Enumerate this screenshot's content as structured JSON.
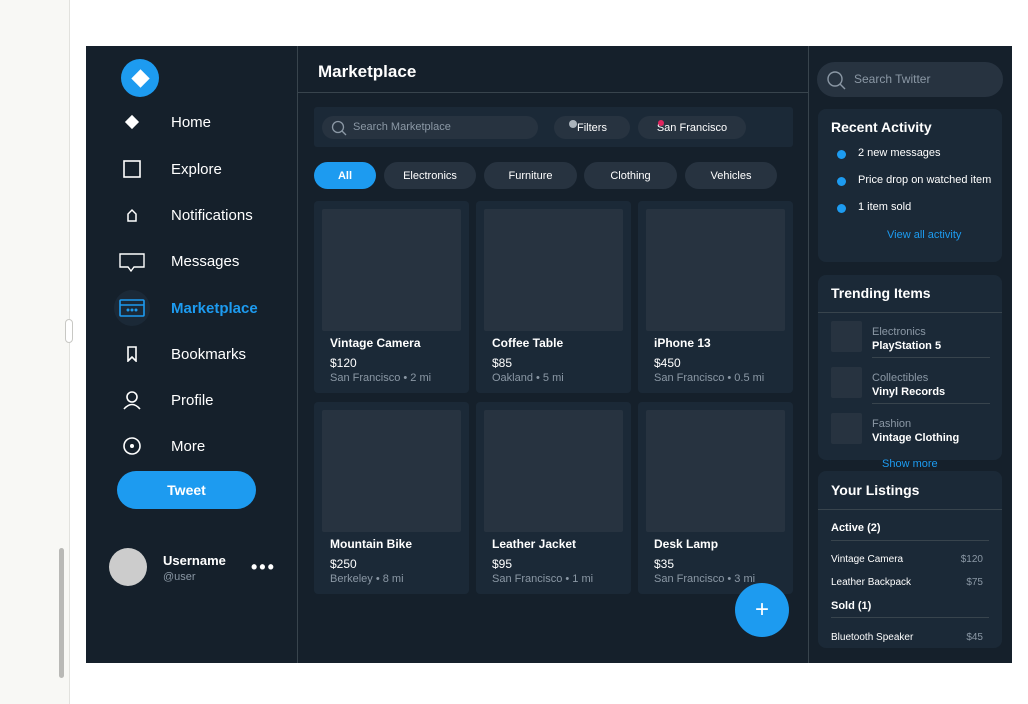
{
  "sidebar": {
    "nav": [
      {
        "label": "Home",
        "icon": "home-diamond-icon"
      },
      {
        "label": "Explore",
        "icon": "explore-square-icon"
      },
      {
        "label": "Notifications",
        "icon": "bell-icon"
      },
      {
        "label": "Messages",
        "icon": "message-bubble-icon"
      },
      {
        "label": "Marketplace",
        "icon": "storefront-icon",
        "active": true
      },
      {
        "label": "Bookmarks",
        "icon": "bookmark-icon"
      },
      {
        "label": "Profile",
        "icon": "user-icon"
      },
      {
        "label": "More",
        "icon": "more-circle-icon"
      }
    ],
    "tweet_label": "Tweet",
    "user": {
      "name": "Username",
      "handle": "@user",
      "more": "•••"
    }
  },
  "main": {
    "title": "Marketplace",
    "search_placeholder": "Search Marketplace",
    "filters_label": "Filters",
    "location_label": "San Francisco",
    "categories": [
      "All",
      "Electronics",
      "Furniture",
      "Clothing",
      "Vehicles"
    ],
    "active_category": "All",
    "listings": [
      {
        "title": "Vintage Camera",
        "price": "$120",
        "location": "San Francisco • 2 mi"
      },
      {
        "title": "Coffee Table",
        "price": "$85",
        "location": "Oakland • 5 mi"
      },
      {
        "title": "iPhone 13",
        "price": "$450",
        "location": "San Francisco • 0.5 mi"
      },
      {
        "title": "Mountain Bike",
        "price": "$250",
        "location": "Berkeley • 8 mi"
      },
      {
        "title": "Leather Jacket",
        "price": "$95",
        "location": "San Francisco • 1 mi"
      },
      {
        "title": "Desk Lamp",
        "price": "$35",
        "location": "San Francisco • 3 mi"
      }
    ],
    "fab_label": "+"
  },
  "right": {
    "search_placeholder": "Search Twitter",
    "recent_activity": {
      "title": "Recent Activity",
      "items": [
        "2 new messages",
        "Price drop on watched item",
        "1 item sold"
      ],
      "link": "View all activity"
    },
    "trending": {
      "title": "Trending Items",
      "items": [
        {
          "category": "Electronics",
          "name": "PlayStation 5"
        },
        {
          "category": "Collectibles",
          "name": "Vinyl Records"
        },
        {
          "category": "Fashion",
          "name": "Vintage Clothing"
        }
      ],
      "link": "Show more"
    },
    "listings": {
      "title": "Your Listings",
      "active_head": "Active (2)",
      "active": [
        {
          "name": "Vintage Camera",
          "price": "$120"
        },
        {
          "name": "Leather Backpack",
          "price": "$75"
        }
      ],
      "sold_head": "Sold (1)",
      "sold": [
        {
          "name": "Bluetooth Speaker",
          "price": "$45"
        }
      ]
    }
  },
  "colors": {
    "accent": "#1d9bf0",
    "background": "#15202b",
    "card": "#1b2937",
    "muted": "#8b98a5"
  }
}
